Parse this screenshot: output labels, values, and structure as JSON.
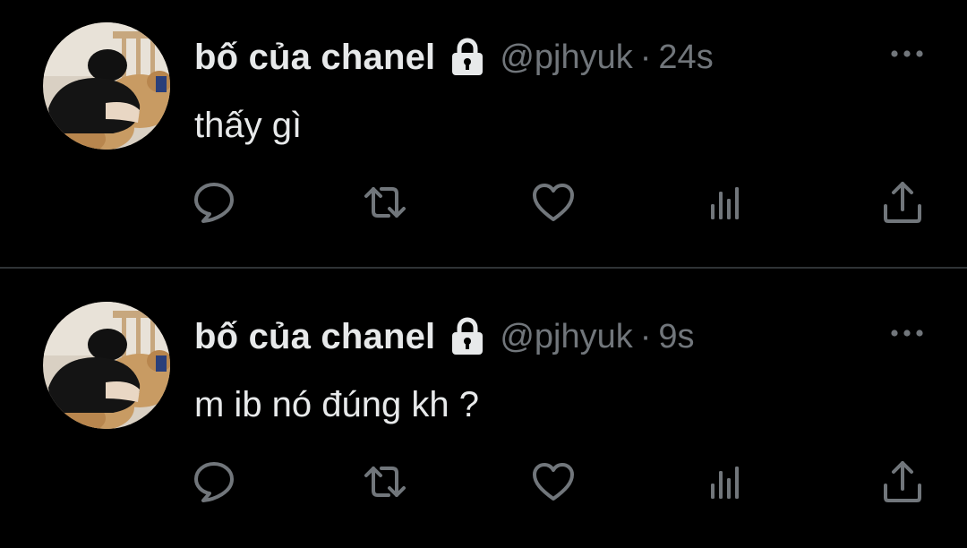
{
  "colors": {
    "background": "#000000",
    "primary_text": "#e7e9ea",
    "secondary_text": "#71767b",
    "divider": "#2f3336"
  },
  "tweets": [
    {
      "display_name": "bố của chanel",
      "handle": "@pjhyuk",
      "separator": "·",
      "time": "24s",
      "text": "thấy gì",
      "protected": true,
      "actions": [
        "reply-icon",
        "retweet-icon",
        "like-icon",
        "views-icon",
        "share-icon"
      ]
    },
    {
      "display_name": "bố của chanel",
      "handle": "@pjhyuk",
      "separator": "·",
      "time": "9s",
      "text": "m ib nó đúng kh ?",
      "protected": true,
      "actions": [
        "reply-icon",
        "retweet-icon",
        "like-icon",
        "views-icon",
        "share-icon"
      ]
    }
  ]
}
